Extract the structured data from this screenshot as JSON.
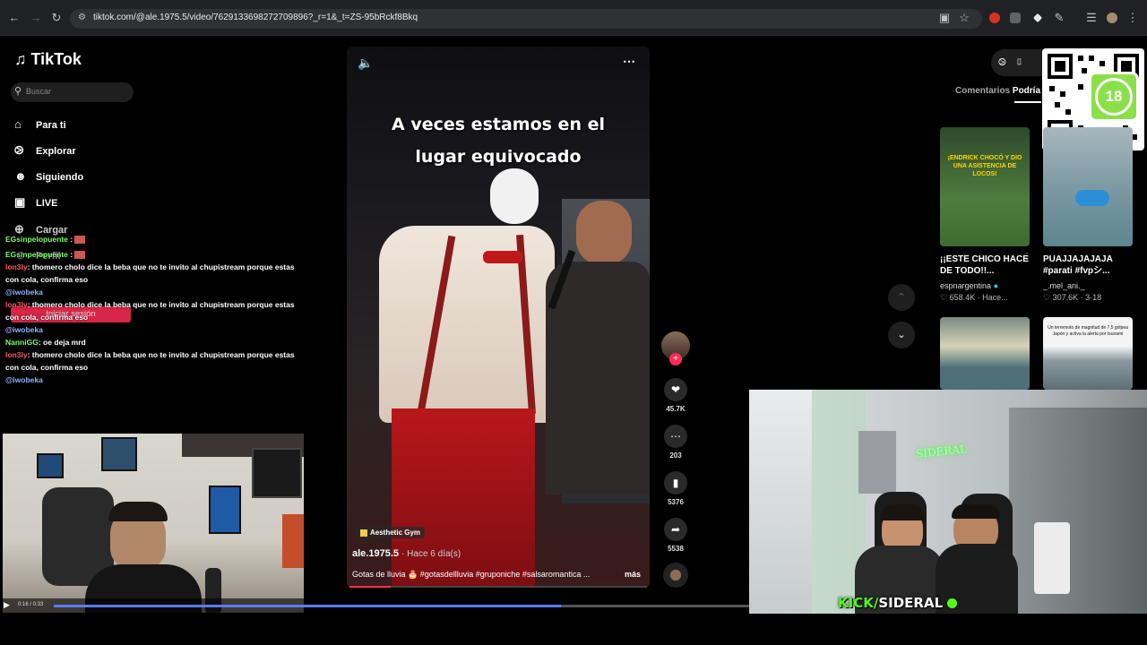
{
  "browser": {
    "url": "tiktok.com/@ale.1975.5/video/7629133698272709896?_r=1&_t=ZS-95bRckf8Bkq"
  },
  "sidebar": {
    "logo": "TikTok",
    "search_placeholder": "Buscar",
    "items": [
      {
        "label": "Para ti",
        "icon": "home-icon"
      },
      {
        "label": "Explorar",
        "icon": "compass-icon"
      },
      {
        "label": "Siguiendo",
        "icon": "following-icon"
      },
      {
        "label": "LIVE",
        "icon": "live-icon"
      },
      {
        "label": "Cargar",
        "icon": "upload-icon"
      },
      {
        "label": "Perfil",
        "icon": "profile-icon"
      }
    ],
    "login_button": "Iniciar sesión"
  },
  "chat": [
    {
      "user": "EGsinpelopuente",
      "msg": "",
      "color": "green"
    },
    {
      "user": "EGsinpelopuente",
      "msg": "",
      "color": "green"
    },
    {
      "user": "lon3ly",
      "msg": ": thomero cholo dice la beba que no te invito al chupistream porque estas con cola, confirma eso",
      "color": "red"
    },
    {
      "user": "@iwobeka",
      "msg": "",
      "color": "blue"
    },
    {
      "user": "lon3ly",
      "msg": ": thomero cholo dice la beba que no te invito al chupistream porque estas con cola, confirma eso",
      "color": "red"
    },
    {
      "user": "@iwobeka",
      "msg": "",
      "color": "blue"
    },
    {
      "user": "NanniGG",
      "msg": ": oe deja mrd",
      "color": "green"
    },
    {
      "user": "lon3ly",
      "msg": ": thomero cholo dice la beba que no te invito al chupistream porque estas con cola, confirma eso",
      "color": "red"
    },
    {
      "user": "@iwobeka",
      "msg": "",
      "color": "blue"
    }
  ],
  "video": {
    "caption_line1": "A veces estamos en el",
    "caption_line2": "lugar equivocado",
    "sound_tag": "Aesthetic Gym",
    "author": "ale.1975.5",
    "posted": "Hace 6 día(s)",
    "description": "Gotas de lluvia 🎂 #gotasdellluvia #gruponiche #salsaromantica ...",
    "more": "más",
    "progress": 0.14
  },
  "actions": {
    "likes": "45.7K",
    "comments": "203",
    "saves": "5376",
    "shares": "5538"
  },
  "right_panel": {
    "tabs": [
      "Comentarios",
      "Podría"
    ],
    "videos": [
      {
        "thumb_text": "¡ENDRICK CHOCÓ Y DIO UNA ASISTENCIA DE LOCOS!",
        "caption": "¡¡ESTE CHICO HACE DE TODO!!...",
        "author": "espnargentina",
        "likes": "658.4K",
        "date": "Hace..."
      },
      {
        "thumb_text": "",
        "caption": "PUAJJAJAJAJA #parati #fvpシ...",
        "author": "_.mel_ani._",
        "likes": "307.6K",
        "date": "3-18"
      },
      {
        "thumb_text": "",
        "caption": "",
        "author": "",
        "likes": "",
        "date": ""
      },
      {
        "thumb_text": "Un terremoto de magnitud de 7,5 golpea Japón y activa la alerta por tsunami",
        "caption": "",
        "author": "",
        "likes": "",
        "date": ""
      }
    ],
    "qr_badge": "18"
  },
  "stream": {
    "badge_left": "KICK",
    "badge_right": "SIDERAL",
    "neon_sign": "SIDERAL",
    "time": "0:16 / 0:33",
    "seek": 0.73
  }
}
